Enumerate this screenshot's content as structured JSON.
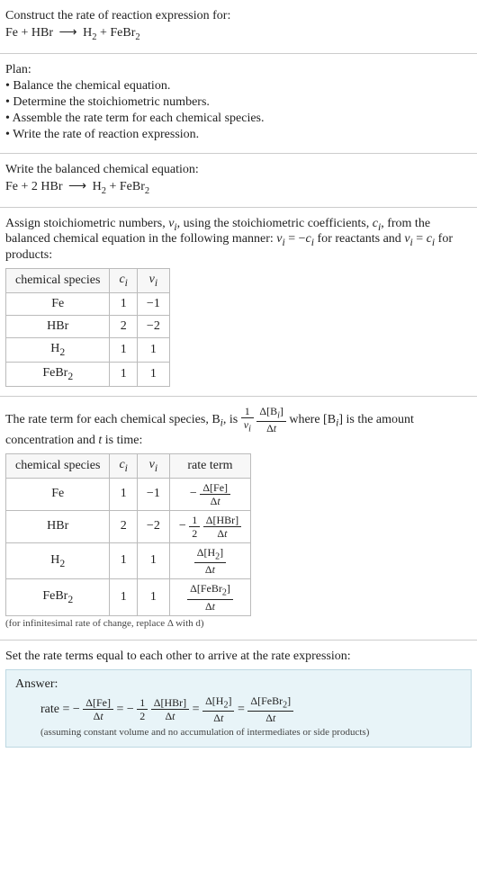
{
  "intro": {
    "title": "Construct the rate of reaction expression for:",
    "equation_html": "Fe + HBr <span class='arrow'>&#10230;</span> H<sub>2</sub> + FeBr<sub>2</sub>"
  },
  "plan": {
    "heading": "Plan:",
    "items": [
      "• Balance the chemical equation.",
      "• Determine the stoichiometric numbers.",
      "• Assemble the rate term for each chemical species.",
      "• Write the rate of reaction expression."
    ]
  },
  "balanced": {
    "heading": "Write the balanced chemical equation:",
    "equation_html": "Fe + 2 HBr <span class='arrow'>&#10230;</span> H<sub>2</sub> + FeBr<sub>2</sub>"
  },
  "assign": {
    "text_html": "Assign stoichiometric numbers, <span class='italic'>ν<sub>i</sub></span>, using the stoichiometric coefficients, <span class='italic'>c<sub>i</sub></span>, from the balanced chemical equation in the following manner: <span class='italic'>ν<sub>i</sub></span> = −<span class='italic'>c<sub>i</sub></span> for reactants and <span class='italic'>ν<sub>i</sub></span> = <span class='italic'>c<sub>i</sub></span> for products:",
    "headers": [
      "chemical species",
      "c_i",
      "ν_i"
    ],
    "rows": [
      {
        "species_html": "Fe",
        "c": "1",
        "nu": "−1"
      },
      {
        "species_html": "HBr",
        "c": "2",
        "nu": "−2"
      },
      {
        "species_html": "H<sub>2</sub>",
        "c": "1",
        "nu": "1"
      },
      {
        "species_html": "FeBr<sub>2</sub>",
        "c": "1",
        "nu": "1"
      }
    ]
  },
  "rateterm": {
    "text_pre": "The rate term for each chemical species, B",
    "text_mid1": ", is ",
    "text_mid2": " where [B",
    "text_post": "] is the amount concentration and ",
    "text_tvar": "t",
    "text_end": " is time:",
    "headers": [
      "chemical species",
      "c_i",
      "ν_i",
      "rate term"
    ],
    "rows": [
      {
        "species_html": "Fe",
        "c": "1",
        "nu": "−1",
        "term_html": "<span class='rt'>− <span class='frac'><span class='num'>Δ[Fe]</span><span class='den'>Δ<span class='italic'>t</span></span></span></span>"
      },
      {
        "species_html": "HBr",
        "c": "2",
        "nu": "−2",
        "term_html": "<span class='rt'>− <span class='frac'><span class='num'>1</span><span class='den'>2</span></span> <span class='frac'><span class='num'>Δ[HBr]</span><span class='den'>Δ<span class='italic'>t</span></span></span></span>"
      },
      {
        "species_html": "H<sub>2</sub>",
        "c": "1",
        "nu": "1",
        "term_html": "<span class='rt'><span class='frac'><span class='num'>Δ[H<sub>2</sub>]</span><span class='den'>Δ<span class='italic'>t</span></span></span></span>"
      },
      {
        "species_html": "FeBr<sub>2</sub>",
        "c": "1",
        "nu": "1",
        "term_html": "<span class='rt'><span class='frac'><span class='num'>Δ[FeBr<sub>2</sub>]</span><span class='den'>Δ<span class='italic'>t</span></span></span></span>"
      }
    ],
    "footnote": "(for infinitesimal rate of change, replace Δ with d)"
  },
  "final": {
    "heading": "Set the rate terms equal to each other to arrive at the rate expression:",
    "answer_label": "Answer:",
    "rate_html": "rate = − <span class='frac'><span class='num'>Δ[Fe]</span><span class='den'>Δ<span class='italic'>t</span></span></span> = − <span class='frac'><span class='num'>1</span><span class='den'>2</span></span> <span class='frac'><span class='num'>Δ[HBr]</span><span class='den'>Δ<span class='italic'>t</span></span></span> = <span class='frac'><span class='num'>Δ[H<sub>2</sub>]</span><span class='den'>Δ<span class='italic'>t</span></span></span> = <span class='frac'><span class='num'>Δ[FeBr<sub>2</sub>]</span><span class='den'>Δ<span class='italic'>t</span></span></span>",
    "assumption": "(assuming constant volume and no accumulation of intermediates or side products)"
  }
}
